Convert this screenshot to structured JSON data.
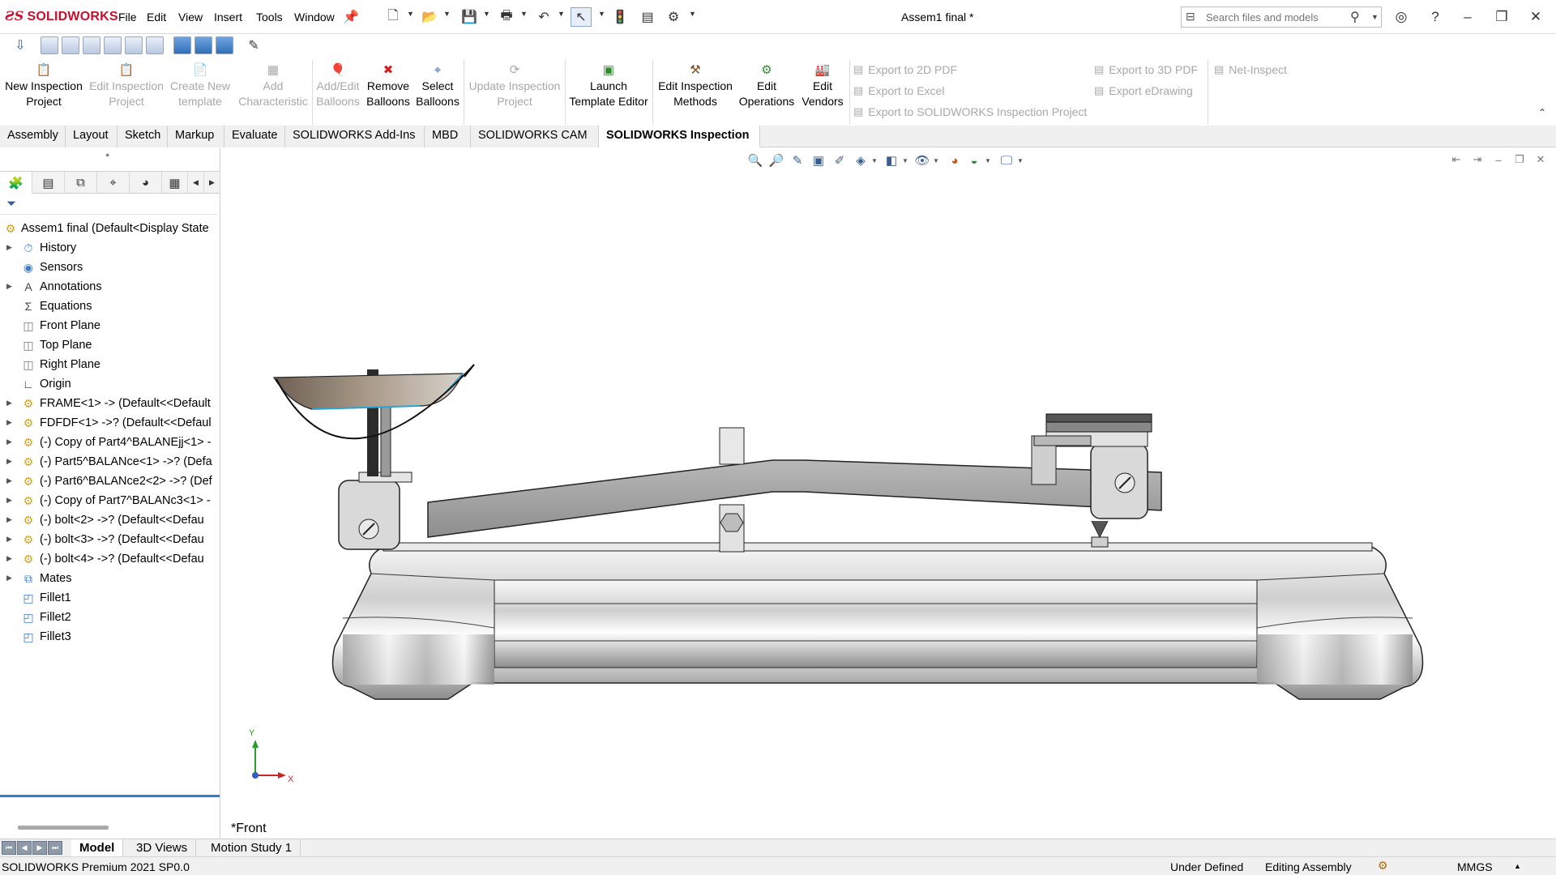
{
  "app": {
    "brand": "SOLIDWORKS",
    "document_title": "Assem1 final *"
  },
  "menu": [
    "File",
    "Edit",
    "View",
    "Insert",
    "Tools",
    "Window"
  ],
  "search": {
    "placeholder": "Search files and models"
  },
  "command_manager": {
    "buttons": [
      {
        "label": "New Inspection Project",
        "enabled": true,
        "icon": "inspection-project-icon"
      },
      {
        "label": "Edit Inspection Project",
        "enabled": false,
        "icon": "edit-project-icon"
      },
      {
        "label": "Create New template",
        "enabled": false,
        "icon": "template-icon"
      },
      {
        "label": "Add Characteristic",
        "enabled": false,
        "icon": "characteristic-icon"
      },
      {
        "label": "Add/Edit Balloons",
        "enabled": false,
        "icon": "balloon-icon"
      },
      {
        "label": "Remove Balloons",
        "enabled": true,
        "icon": "remove-balloon-icon"
      },
      {
        "label": "Select Balloons",
        "enabled": true,
        "icon": "select-balloon-icon"
      },
      {
        "label": "Update Inspection Project",
        "enabled": false,
        "icon": "update-icon"
      },
      {
        "label": "Launch Template Editor",
        "enabled": true,
        "icon": "template-editor-icon"
      },
      {
        "label": "Edit Inspection Methods",
        "enabled": true,
        "icon": "methods-icon"
      },
      {
        "label": "Edit Operations",
        "enabled": true,
        "icon": "operations-icon"
      },
      {
        "label": "Edit Vendors",
        "enabled": true,
        "icon": "vendors-icon"
      }
    ],
    "exports_left": [
      "Export to 2D PDF",
      "Export to Excel",
      "Export to SOLIDWORKS Inspection Project"
    ],
    "exports_right": [
      "Export to 3D PDF",
      "Export eDrawing"
    ],
    "net_inspect": "Net-Inspect"
  },
  "tabs": [
    "Assembly",
    "Layout",
    "Sketch",
    "Markup",
    "Evaluate",
    "SOLIDWORKS Add-Ins",
    "MBD",
    "SOLIDWORKS CAM",
    "SOLIDWORKS Inspection"
  ],
  "active_tab": "SOLIDWORKS Inspection",
  "feature_tree": [
    {
      "label": "Assem1 final  (Default<Display State",
      "icon": "assembly-icon",
      "expand": false,
      "indent": 0
    },
    {
      "label": "History",
      "icon": "history-icon",
      "expand": true,
      "indent": 1
    },
    {
      "label": "Sensors",
      "icon": "sensor-icon",
      "expand": false,
      "indent": 1
    },
    {
      "label": "Annotations",
      "icon": "annotations-icon",
      "expand": true,
      "indent": 1
    },
    {
      "label": "Equations",
      "icon": "equations-icon",
      "expand": false,
      "indent": 1
    },
    {
      "label": "Front Plane",
      "icon": "plane-icon",
      "expand": false,
      "indent": 1
    },
    {
      "label": "Top Plane",
      "icon": "plane-icon",
      "expand": false,
      "indent": 1
    },
    {
      "label": "Right Plane",
      "icon": "plane-icon",
      "expand": false,
      "indent": 1
    },
    {
      "label": "Origin",
      "icon": "origin-icon",
      "expand": false,
      "indent": 1
    },
    {
      "label": "FRAME<1> -> (Default<<Default",
      "icon": "part-icon",
      "expand": true,
      "indent": 1
    },
    {
      "label": "FDFDF<1> ->? (Default<<Defaul",
      "icon": "part-icon",
      "expand": true,
      "indent": 1
    },
    {
      "label": "(-) Copy of Part4^BALANEjj<1> -",
      "icon": "part-icon",
      "expand": true,
      "indent": 1
    },
    {
      "label": "(-) Part5^BALANce<1> ->? (Defa",
      "icon": "part-icon",
      "expand": true,
      "indent": 1
    },
    {
      "label": "(-) Part6^BALANce2<2> ->? (Def",
      "icon": "part-icon",
      "expand": true,
      "indent": 1
    },
    {
      "label": "(-) Copy of Part7^BALANc3<1> -",
      "icon": "part-icon",
      "expand": true,
      "indent": 1
    },
    {
      "label": "(-) bolt<2> ->? (Default<<Defau",
      "icon": "part-icon",
      "expand": true,
      "indent": 1
    },
    {
      "label": "(-) bolt<3> ->? (Default<<Defau",
      "icon": "part-icon",
      "expand": true,
      "indent": 1
    },
    {
      "label": "(-) bolt<4> ->? (Default<<Defau",
      "icon": "part-icon",
      "expand": true,
      "indent": 1
    },
    {
      "label": "Mates",
      "icon": "mates-icon",
      "expand": true,
      "indent": 1
    },
    {
      "label": "Fillet1",
      "icon": "fillet-icon",
      "expand": false,
      "indent": 1
    },
    {
      "label": "Fillet2",
      "icon": "fillet-icon",
      "expand": false,
      "indent": 1
    },
    {
      "label": "Fillet3",
      "icon": "fillet-icon",
      "expand": false,
      "indent": 1
    }
  ],
  "viewport": {
    "view_name": "*Front",
    "axis_x": "X",
    "axis_y": "Y"
  },
  "bottom_tabs": [
    "Model",
    "3D Views",
    "Motion Study 1"
  ],
  "active_bottom_tab": "Model",
  "status": {
    "product": "SOLIDWORKS Premium 2021 SP0.0",
    "state": "Under Defined",
    "mode": "Editing Assembly",
    "units": "MMGS"
  },
  "colors": {
    "brand_red": "#c8102e",
    "accent_blue": "#2f7ccb"
  }
}
